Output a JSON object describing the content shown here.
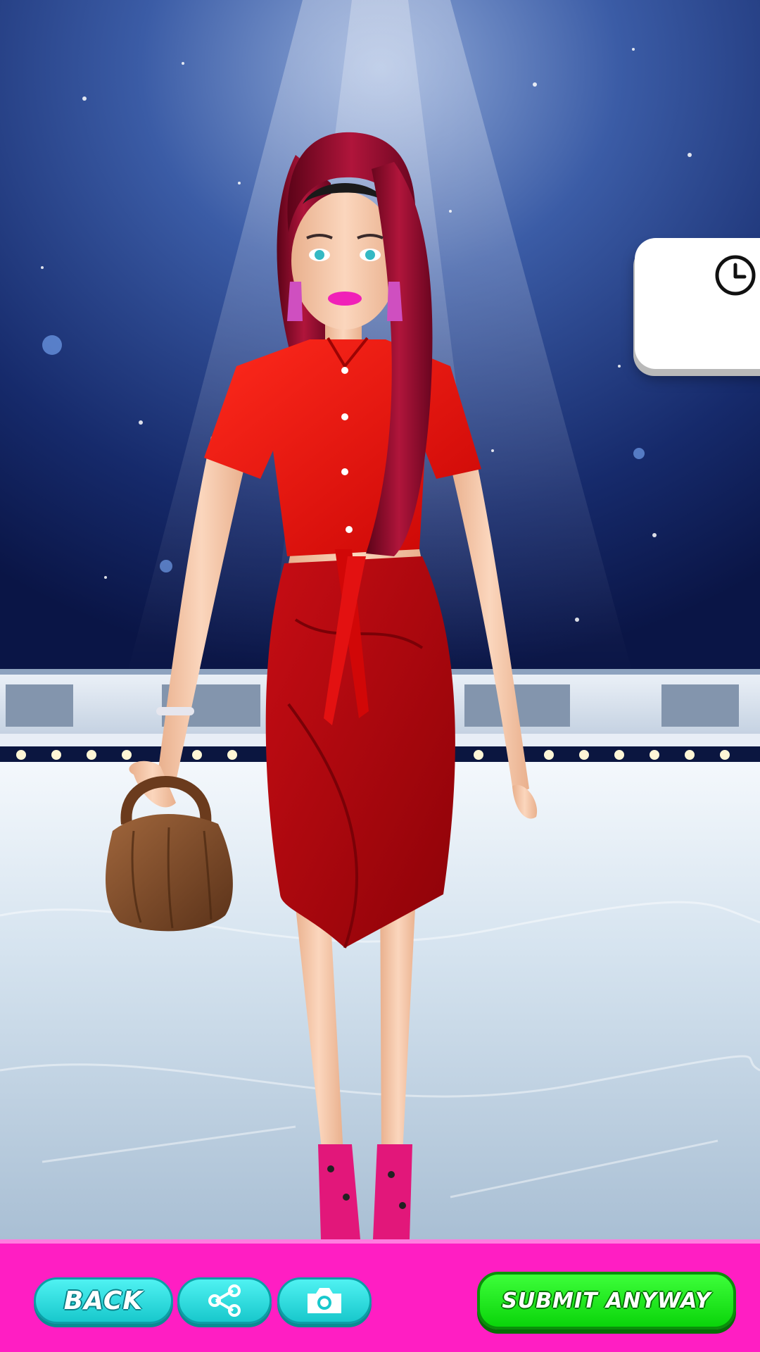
{
  "scene": {
    "name": "ice-rink-stage",
    "model_name": "fashion-doll",
    "outfit": {
      "top": "red tied crop shirt",
      "skirt": "red wrap pencil skirt",
      "bag": "brown ruched handbag",
      "shoes": "pink leopard heels",
      "hair": "burgundy long ponytail"
    },
    "colors": {
      "sky_top": "#0b1a52",
      "sky_mid": "#2d4f96",
      "ice": "#dfe9f2",
      "shirt": "#e40d0d",
      "skirt": "#b3080f",
      "hair": "#8a0a2a",
      "skin": "#f6c9a8"
    }
  },
  "timer": {
    "icon": "clock-icon",
    "value": ""
  },
  "bottom_bar": {
    "background": "#ff1ec3",
    "back_label": "BACK",
    "share_icon": "share-icon",
    "camera_icon": "camera-icon",
    "submit_label": "SUBMIT ANYWAY"
  }
}
